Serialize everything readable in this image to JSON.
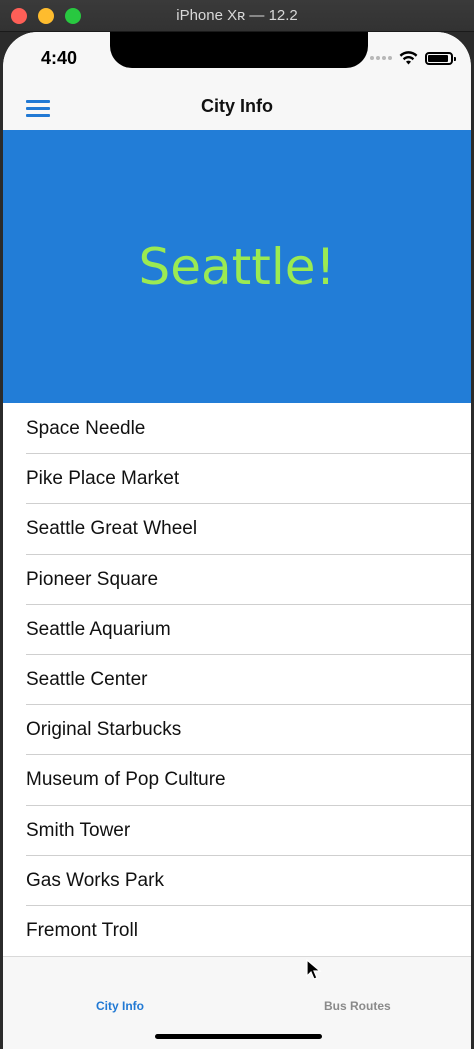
{
  "window": {
    "title": "iPhone Xʀ — 12.2"
  },
  "status_bar": {
    "time": "4:40"
  },
  "nav": {
    "title": "City Info",
    "menu_icon": "hamburger-menu-icon"
  },
  "hero": {
    "title": "Seattle!"
  },
  "list": {
    "items": [
      "Space Needle",
      "Pike Place Market",
      "Seattle Great Wheel",
      "Pioneer Square",
      "Seattle Aquarium",
      "Seattle Center",
      "Original Starbucks",
      "Museum of Pop Culture",
      "Smith Tower",
      "Gas Works Park",
      "Fremont Troll"
    ]
  },
  "tabs": [
    {
      "label": "City Info",
      "active": true
    },
    {
      "label": "Bus Routes",
      "active": false
    }
  ],
  "colors": {
    "accent": "#2179d4",
    "hero_bg": "#227dd7",
    "hero_text": "#9bea52"
  }
}
